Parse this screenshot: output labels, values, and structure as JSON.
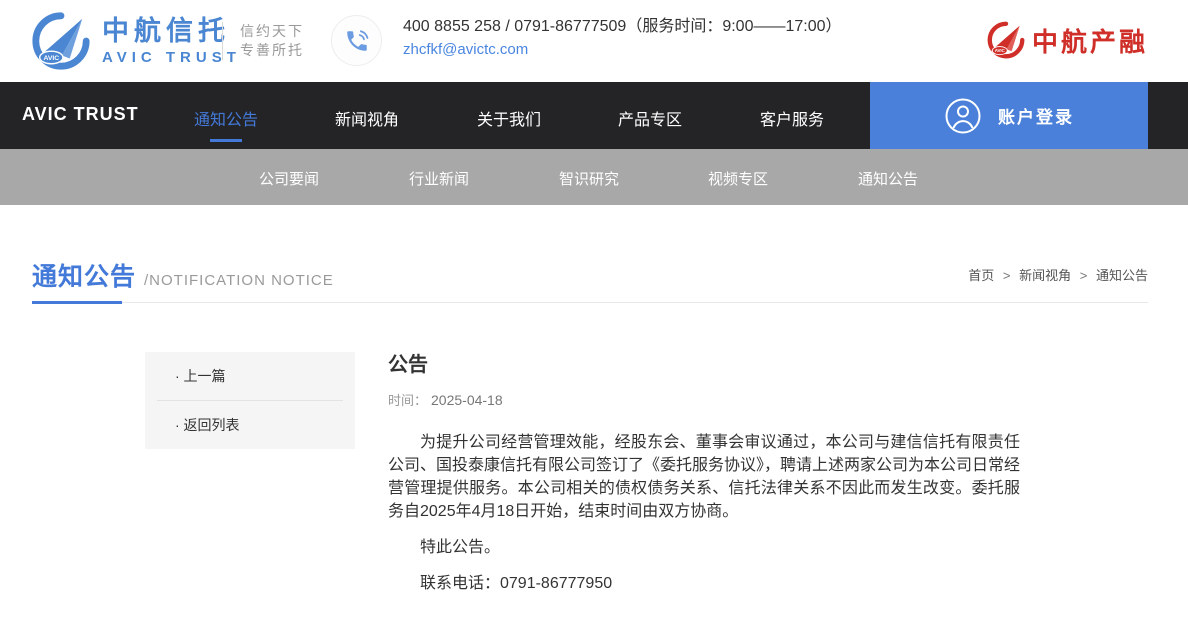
{
  "brand": {
    "name_cn": "中航信托",
    "name_en": "AVIC TRUST",
    "logo_badge": "AVIC",
    "slogan_line1": "信约天下",
    "slogan_line2": "专善所托",
    "phone_line": "400 8855 258 / 0791-86777509（服务时间：9:00——17:00）",
    "email": "zhcfkf@avictc.com",
    "partner_name": "中航产融",
    "partner_badge": "AVIC"
  },
  "nav": {
    "brand": "AVIC TRUST",
    "items": [
      {
        "label": "通知公告",
        "active": true
      },
      {
        "label": "新闻视角",
        "active": false
      },
      {
        "label": "关于我们",
        "active": false
      },
      {
        "label": "产品专区",
        "active": false
      },
      {
        "label": "客户服务",
        "active": false
      }
    ],
    "login_label": "账户登录"
  },
  "subnav": {
    "items": [
      "公司要闻",
      "行业新闻",
      "智识研究",
      "视频专区",
      "通知公告"
    ]
  },
  "page_header": {
    "title_cn": "通知公告",
    "title_en": "/NOTIFICATION NOTICE",
    "breadcrumb": {
      "home": "首页",
      "sep1": ">",
      "section": "新闻视角",
      "sep2": ">",
      "current": "通知公告"
    }
  },
  "article": {
    "sidebar": {
      "prev_label": "· 上一篇",
      "back_label": "· 返回列表"
    },
    "title": "公告",
    "date_label": "时间：",
    "date": "2025-04-18",
    "paragraphs": [
      "为提升公司经营管理效能，经股东会、董事会审议通过，本公司与建信信托有限责任公司、国投泰康信托有限公司签订了《委托服务协议》，聘请上述两家公司为本公司日常经营管理提供服务。本公司相关的债权债务关系、信托法律关系不因此而发生改变。委托服务自2025年4月18日开始，结束时间由双方协商。",
      "特此公告。",
      "联系电话：0791-86777950"
    ]
  },
  "colors": {
    "accent_blue": "#4379d8",
    "brand_blue": "#4a86d2",
    "brand_red": "#cf2f28",
    "nav_dark": "#242427",
    "subnav_gray": "#a8a8a8"
  }
}
